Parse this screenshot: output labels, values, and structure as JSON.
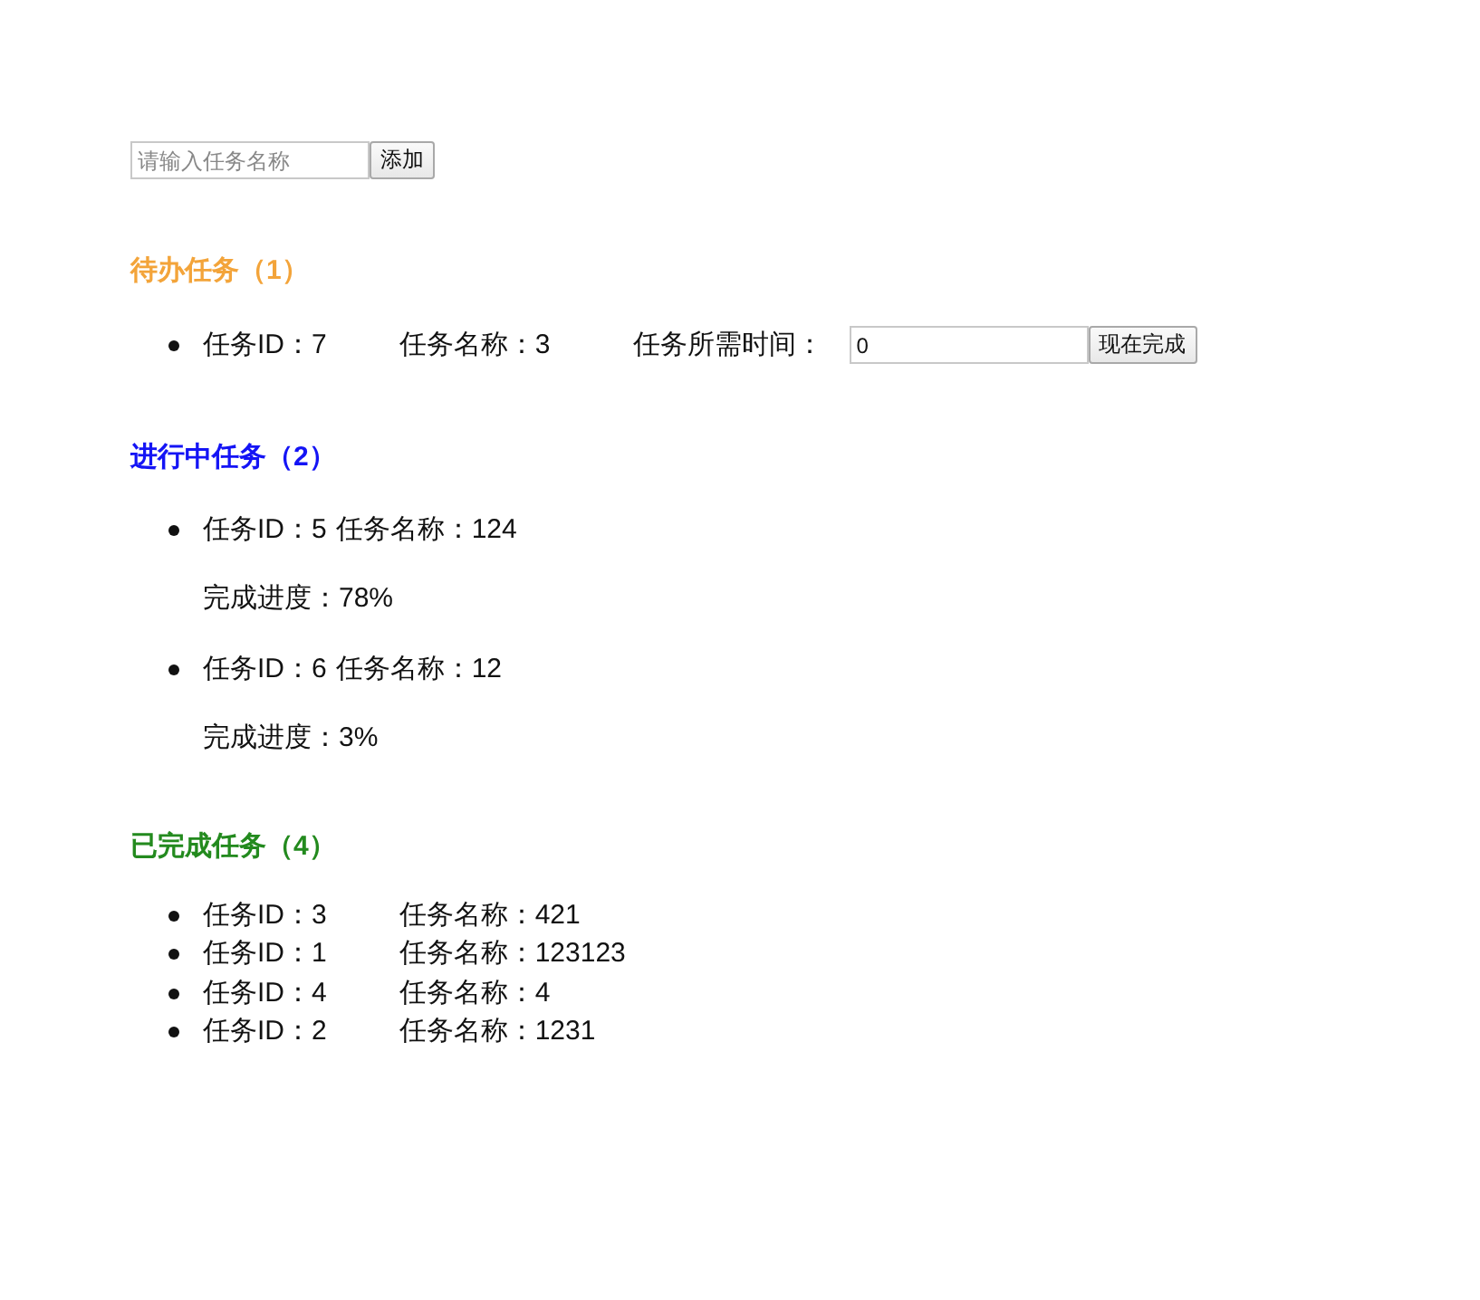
{
  "new_task": {
    "placeholder": "请输入任务名称",
    "button": "添加"
  },
  "sections": [
    {
      "kind": "todo",
      "title": "待办任务（1）",
      "color": "#f3a43a",
      "items": [
        {
          "id_label": "任务ID：7",
          "name_label": "任务名称：3",
          "time_label": "任务所需时间：",
          "time_value": "0",
          "button": "现在完成"
        }
      ]
    },
    {
      "kind": "in_progress",
      "title": "进行中任务（2）",
      "color": "#1414f5",
      "items": [
        {
          "id_label": "任务ID：5",
          "name_label": "任务名称：124",
          "progress": "完成进度：78%"
        },
        {
          "id_label": "任务ID：6",
          "name_label": "任务名称：12",
          "progress": "完成进度：3%"
        }
      ]
    },
    {
      "kind": "done",
      "title": "已完成任务（4）",
      "color": "#238a1e",
      "items": [
        {
          "id_label": "任务ID：3",
          "name_label": "任务名称：421"
        },
        {
          "id_label": "任务ID：1",
          "name_label": "任务名称：123123"
        },
        {
          "id_label": "任务ID：4",
          "name_label": "任务名称：4"
        },
        {
          "id_label": "任务ID：2",
          "name_label": "任务名称：1231"
        }
      ]
    }
  ]
}
